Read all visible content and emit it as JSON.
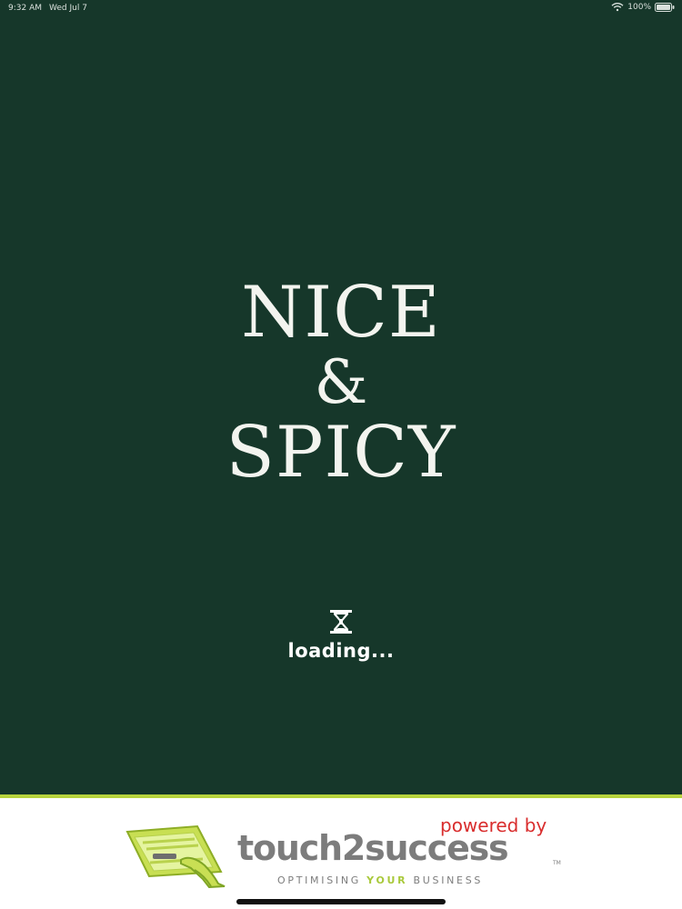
{
  "status_bar": {
    "time": "9:32 AM",
    "date": "Wed Jul 7",
    "battery": "100%"
  },
  "app": {
    "logo_line_1": "NICE",
    "logo_ampersand": "&",
    "logo_line_2": "SPICY",
    "loading_text": "loading..."
  },
  "footer": {
    "powered_by": "powered by",
    "brand_name": "touch2success",
    "brand_tm": "TM",
    "tagline_prefix": "OPTIMISING ",
    "tagline_highlight": "YOUR",
    "tagline_suffix": " BUSINESS"
  },
  "icons": {
    "loading": "hourglass-icon",
    "wifi": "wifi-icon",
    "battery": "battery-icon",
    "brand": "touch2success-icon"
  },
  "colors": {
    "background": "#16372a",
    "accent": "#b7d33d",
    "powered_by": "#d92d2d",
    "brand_gray": "#7c7c7c"
  }
}
